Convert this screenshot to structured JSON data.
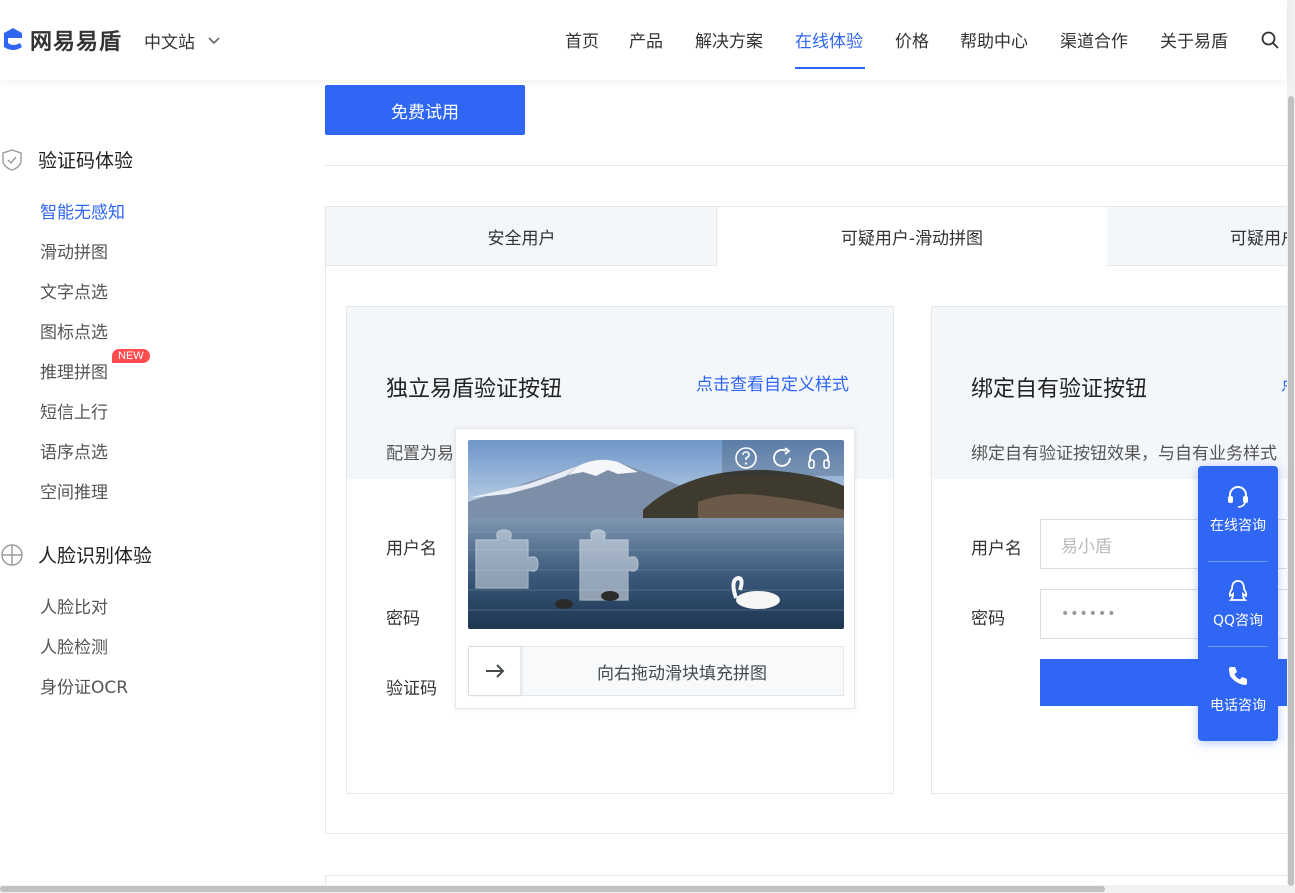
{
  "header": {
    "logo_text": "网易易盾",
    "site_switch": "中文站",
    "nav": [
      "首页",
      "产品",
      "解决方案",
      "在线体验",
      "价格",
      "帮助中心",
      "渠道合作",
      "关于易盾"
    ],
    "active_nav": "在线体验"
  },
  "sidebar": {
    "group1_title": "验证码体验",
    "group1_items": [
      "智能无感知",
      "滑动拼图",
      "文字点选",
      "图标点选",
      "推理拼图",
      "短信上行",
      "语序点选",
      "空间推理"
    ],
    "new_badge": "NEW",
    "group2_title": "人脸识别体验",
    "group2_items": [
      "人脸比对",
      "人脸检测",
      "身份证OCR"
    ]
  },
  "main": {
    "trial_button": "免费试用",
    "tabs": [
      "安全用户",
      "可疑用户-滑动拼图",
      "可疑用户"
    ],
    "card_left": {
      "title": "独立易盾验证按钮",
      "link": "点击查看自定义样式",
      "desc": "配置为易",
      "label_user": "用户名",
      "label_pass": "密码",
      "label_code": "验证码"
    },
    "card_right": {
      "title": "绑定自有验证按钮",
      "link": "点",
      "desc": "绑定自有验证按钮效果，与自有业务样式",
      "label_user": "用户名",
      "label_pass": "密码",
      "user_placeholder": "易小盾",
      "pass_value": "••••••"
    }
  },
  "captcha": {
    "slider_hint": "向右拖动滑块填充拼图"
  },
  "float_panel": {
    "items": [
      "在线咨询",
      "QQ咨询",
      "电话咨询"
    ]
  },
  "colors": {
    "brand": "#2F66F3",
    "badge": "#FF4D4F"
  }
}
